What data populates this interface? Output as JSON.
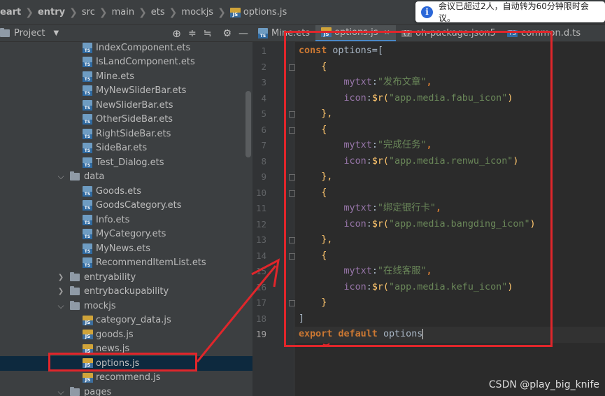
{
  "breadcrumb": [
    {
      "label": "eart",
      "bold": true
    },
    {
      "label": "entry",
      "bold": true
    },
    {
      "label": "src",
      "bold": false
    },
    {
      "label": "main",
      "bold": false
    },
    {
      "label": "ets",
      "bold": false
    },
    {
      "label": "mockjs",
      "bold": false
    },
    {
      "label": "options.js",
      "bold": false,
      "icon": "js"
    }
  ],
  "notification": {
    "text": "会议已超过2人，自动转为60分钟限时会议。"
  },
  "project_panel": {
    "title": "Project",
    "tools": [
      "target-icon",
      "expand-icon",
      "collapse-icon",
      "gear-icon",
      "minimize-icon"
    ]
  },
  "tree": [
    {
      "label": "IndexComponent.ets",
      "depth": 3,
      "type": "ts"
    },
    {
      "label": "IsLandComponent.ets",
      "depth": 3,
      "type": "ts"
    },
    {
      "label": "Mine.ets",
      "depth": 3,
      "type": "ts"
    },
    {
      "label": "MyNewSliderBar.ets",
      "depth": 3,
      "type": "ts"
    },
    {
      "label": "NewSliderBar.ets",
      "depth": 3,
      "type": "ts"
    },
    {
      "label": "OtherSideBar.ets",
      "depth": 3,
      "type": "ts"
    },
    {
      "label": "RightSideBar.ets",
      "depth": 3,
      "type": "ts"
    },
    {
      "label": "SideBar.ets",
      "depth": 3,
      "type": "ts"
    },
    {
      "label": "Test_Dialog.ets",
      "depth": 3,
      "type": "ts"
    },
    {
      "label": "data",
      "depth": 2,
      "type": "folder",
      "expanded": true
    },
    {
      "label": "Goods.ets",
      "depth": 3,
      "type": "ts"
    },
    {
      "label": "GoodsCategory.ets",
      "depth": 3,
      "type": "ts"
    },
    {
      "label": "Info.ets",
      "depth": 3,
      "type": "ts"
    },
    {
      "label": "MyCategory.ets",
      "depth": 3,
      "type": "ts"
    },
    {
      "label": "MyNews.ets",
      "depth": 3,
      "type": "ts"
    },
    {
      "label": "RecommendItemList.ets",
      "depth": 3,
      "type": "ts"
    },
    {
      "label": "entryability",
      "depth": 2,
      "type": "folder",
      "expanded": false
    },
    {
      "label": "entrybackupability",
      "depth": 2,
      "type": "folder",
      "expanded": false
    },
    {
      "label": "mockjs",
      "depth": 2,
      "type": "folder",
      "expanded": true
    },
    {
      "label": "category_data.js",
      "depth": 3,
      "type": "js"
    },
    {
      "label": "goods.js",
      "depth": 3,
      "type": "js"
    },
    {
      "label": "news.js",
      "depth": 3,
      "type": "js"
    },
    {
      "label": "options.js",
      "depth": 3,
      "type": "js",
      "selected": true
    },
    {
      "label": "recommend.js",
      "depth": 3,
      "type": "js"
    },
    {
      "label": "pages",
      "depth": 2,
      "type": "folder",
      "expanded": true
    }
  ],
  "tabs": [
    {
      "label": "Mine.ets",
      "type": "ts",
      "active": false,
      "close": false
    },
    {
      "label": "options.js",
      "type": "js",
      "active": true,
      "close": true
    },
    {
      "label": "oh-package.json5",
      "type": "json",
      "active": false,
      "close": false
    },
    {
      "label": "common.d.ts",
      "type": "dts",
      "active": false,
      "close": false
    }
  ],
  "editor": {
    "line_numbers": [
      "1",
      "2",
      "3",
      "4",
      "5",
      "6",
      "7",
      "8",
      "9",
      "10",
      "11",
      "12",
      "13",
      "14",
      "15",
      "16",
      "17",
      "18",
      "19"
    ],
    "lines": [
      [
        {
          "t": "const ",
          "c": "kw"
        },
        {
          "t": "options=[",
          "c": ""
        }
      ],
      [
        {
          "t": "    {",
          "c": "fn"
        }
      ],
      [
        {
          "t": "        ",
          "c": ""
        },
        {
          "t": "mytxt",
          "c": "prop"
        },
        {
          "t": ":",
          "c": ""
        },
        {
          "t": "\"发布文章\"",
          "c": "str"
        },
        {
          "t": ",",
          "c": "kw"
        }
      ],
      [
        {
          "t": "        ",
          "c": ""
        },
        {
          "t": "icon",
          "c": "prop"
        },
        {
          "t": ":",
          "c": ""
        },
        {
          "t": "$r(",
          "c": "fn"
        },
        {
          "t": "\"app.media.fabu_icon\"",
          "c": "str"
        },
        {
          "t": ")",
          "c": "fn"
        }
      ],
      [
        {
          "t": "    },",
          "c": "fn"
        }
      ],
      [
        {
          "t": "    {",
          "c": "fn"
        }
      ],
      [
        {
          "t": "        ",
          "c": ""
        },
        {
          "t": "mytxt",
          "c": "prop"
        },
        {
          "t": ":",
          "c": ""
        },
        {
          "t": "\"完成任务\"",
          "c": "str"
        },
        {
          "t": ",",
          "c": "kw"
        }
      ],
      [
        {
          "t": "        ",
          "c": ""
        },
        {
          "t": "icon",
          "c": "prop"
        },
        {
          "t": ":",
          "c": ""
        },
        {
          "t": "$r(",
          "c": "fn"
        },
        {
          "t": "\"app.media.renwu_icon\"",
          "c": "str"
        },
        {
          "t": ")",
          "c": "fn"
        }
      ],
      [
        {
          "t": "    },",
          "c": "fn"
        }
      ],
      [
        {
          "t": "    {",
          "c": "fn"
        }
      ],
      [
        {
          "t": "        ",
          "c": ""
        },
        {
          "t": "mytxt",
          "c": "prop"
        },
        {
          "t": ":",
          "c": ""
        },
        {
          "t": "\"绑定银行卡\"",
          "c": "str"
        },
        {
          "t": ",",
          "c": "kw"
        }
      ],
      [
        {
          "t": "        ",
          "c": ""
        },
        {
          "t": "icon",
          "c": "prop"
        },
        {
          "t": ":",
          "c": ""
        },
        {
          "t": "$r(",
          "c": "fn"
        },
        {
          "t": "\"app.media.bangding_icon\"",
          "c": "str"
        },
        {
          "t": ")",
          "c": "fn"
        }
      ],
      [
        {
          "t": "    },",
          "c": "fn"
        }
      ],
      [
        {
          "t": "    {",
          "c": "fn"
        }
      ],
      [
        {
          "t": "        ",
          "c": ""
        },
        {
          "t": "mytxt",
          "c": "prop"
        },
        {
          "t": ":",
          "c": ""
        },
        {
          "t": "\"在线客服\"",
          "c": "str"
        },
        {
          "t": ",",
          "c": "kw"
        }
      ],
      [
        {
          "t": "        ",
          "c": ""
        },
        {
          "t": "icon",
          "c": "prop"
        },
        {
          "t": ":",
          "c": ""
        },
        {
          "t": "$r(",
          "c": "fn"
        },
        {
          "t": "\"app.media.kefu_icon\"",
          "c": "str"
        },
        {
          "t": ")",
          "c": "fn"
        }
      ],
      [
        {
          "t": "    }",
          "c": "fn"
        }
      ],
      [
        {
          "t": "]",
          "c": ""
        }
      ],
      [
        {
          "t": "export ",
          "c": "kw"
        },
        {
          "t": "default ",
          "c": "kw"
        },
        {
          "t": "options",
          "c": ""
        }
      ]
    ]
  },
  "watermark": "CSDN @play_big_knife",
  "colors": {
    "annotation": "#e0262b",
    "selection": "#0d293e",
    "accent": "#4a88c7"
  }
}
